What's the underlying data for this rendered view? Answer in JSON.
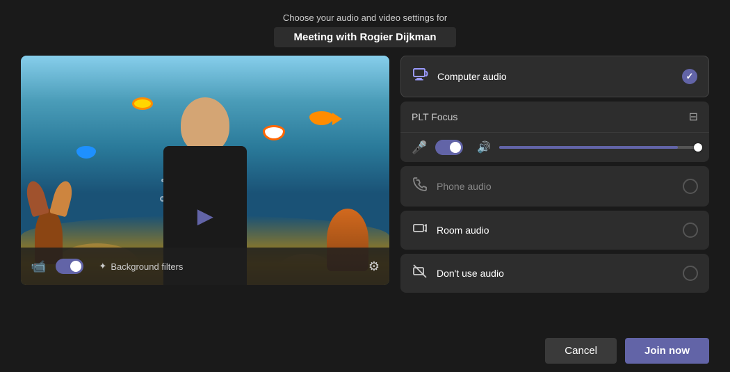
{
  "header": {
    "subtitle": "Choose your audio and video settings for",
    "title": "Meeting with Rogier Dijkman"
  },
  "video": {
    "bg_filters_label": "Background filters"
  },
  "audio": {
    "computer_audio_label": "Computer audio",
    "plt_focus_label": "PLT Focus",
    "phone_audio_label": "Phone audio",
    "room_audio_label": "Room audio",
    "no_audio_label": "Don't use audio"
  },
  "buttons": {
    "cancel_label": "Cancel",
    "join_label": "Join now"
  },
  "colors": {
    "accent": "#6264a7",
    "bg": "#1a1a1a",
    "panel": "#2d2d2d"
  }
}
